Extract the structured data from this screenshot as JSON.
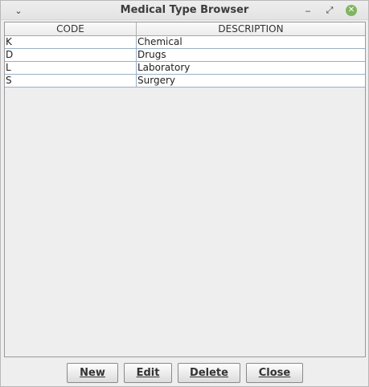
{
  "window": {
    "title": "Medical Type Browser",
    "menu_glyph": "⌄",
    "min_glyph": "‒",
    "max_glyph": "⤢",
    "close_glyph": "✕"
  },
  "table": {
    "columns": [
      "CODE",
      "DESCRIPTION"
    ],
    "rows": [
      {
        "code": "K",
        "description": "Chemical"
      },
      {
        "code": "D",
        "description": "Drugs"
      },
      {
        "code": "L",
        "description": "Laboratory"
      },
      {
        "code": "S",
        "description": "Surgery"
      }
    ]
  },
  "buttons": {
    "new": "New",
    "edit": "Edit",
    "delete": "Delete",
    "close": "Close"
  }
}
